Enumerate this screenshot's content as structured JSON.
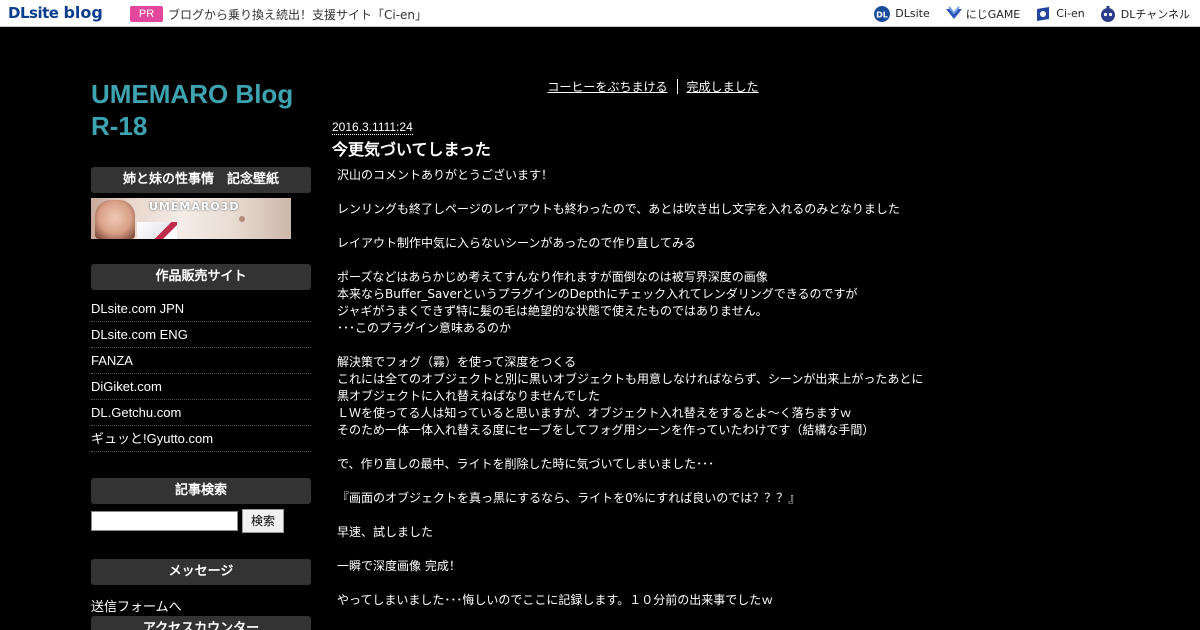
{
  "topbar": {
    "logo_dl": "DLsite",
    "logo_blog": "blog",
    "pr_label": "PR",
    "pr_text": "ブログから乗り換え続出！支援サイト「Ci-en」",
    "links": [
      {
        "label": "DLsite",
        "icon": "dlsite-icon"
      },
      {
        "label": "にじGAME",
        "icon": "nijigame-icon"
      },
      {
        "label": "Ci-en",
        "icon": "cien-icon"
      },
      {
        "label": "DLチャンネル",
        "icon": "dlchannel-icon"
      }
    ]
  },
  "sidebar": {
    "blog_title_line1": "UMEMARO Blog",
    "blog_title_line2": "R-18",
    "section1_title": "姉と妹の性事情　記念壁紙",
    "banner_text": "UMEMARO3D",
    "section2_title": "作品販売サイト",
    "sites": [
      "DLsite.com JPN",
      "DLsite.com ENG",
      "FANZA",
      "DiGiket.com",
      "DL.Getchu.com",
      "ギュッと!Gyutto.com"
    ],
    "section3_title": "記事検索",
    "search_value": "",
    "search_button": "検索",
    "section4_title": "メッセージ",
    "message_link": "送信フォームへ",
    "section5_title": "アクセスカウンター"
  },
  "main": {
    "nav_prev": "コーヒーをぶちまける",
    "nav_next": "完成しました",
    "post_date": "2016.3.1111:24",
    "post_title": "今更気づいてしまった",
    "body_lines": [
      "沢山のコメントありがとうございます！",
      "",
      "レンリングも終了しページのレイアウトも終わったので、あとは吹き出し文字を入れるのみとなりました",
      "",
      "レイアウト制作中気に入らないシーンがあったので作り直してみる",
      "",
      "ポーズなどはあらかじめ考えてすんなり作れますが面倒なのは被写界深度の画像",
      "本来ならBuffer_SaverというプラグインのDepthにチェック入れてレンダリングできるのですが",
      "ジャギがうまくできず特に髪の毛は絶望的な状態で使えたものではありません。",
      "･･･このプラグイン意味あるのか",
      "",
      "解決策でフォグ（霧）を使って深度をつくる",
      "これには全てのオブジェクトと別に黒いオブジェクトも用意しなければならず、シーンが出来上がったあとに",
      "黒オブジェクトに入れ替えねばなりませんでした",
      "ＬＷを使ってる人は知っていると思いますが、オブジェクト入れ替えをするとよ～く落ちますｗ",
      "そのため一体一体入れ替える度にセーブをしてフォグ用シーンを作っていたわけです（結構な手間）",
      "",
      "で、作り直しの最中、ライトを削除した時に気づいてしまいました･･･",
      "",
      "『画面のオブジェクトを真っ黒にするなら、ライトを0%にすれば良いのでは？？？』",
      "",
      "早速、試しました",
      "",
      "一瞬で深度画像 完成！",
      "",
      "やってしまいました･･･悔しいのでここに記録します。１０分前の出来事でしたｗ"
    ]
  },
  "colors": {
    "background": "#000000",
    "title_teal": "#3da3b0",
    "pr_pink": "#e2479b",
    "section_head": "#333333"
  }
}
